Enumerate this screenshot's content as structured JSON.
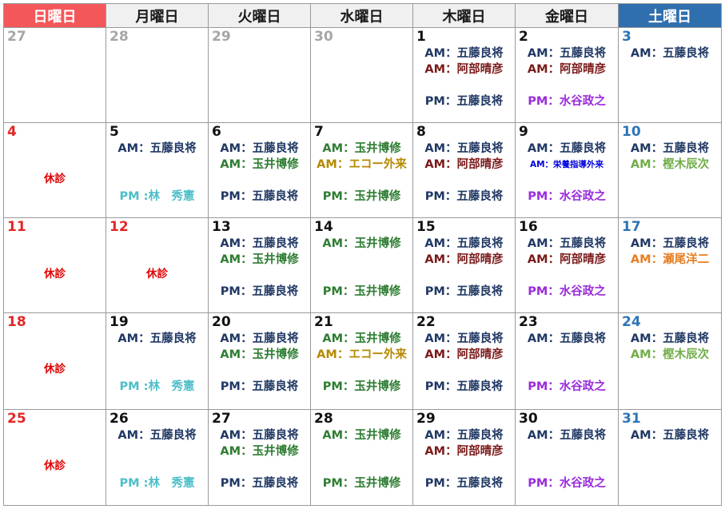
{
  "colors": {
    "sunday_header_bg": "#f4575a",
    "saturday_header_bg": "#2f6fae",
    "header_bg": "#f0f0f0",
    "date_default": "#111111",
    "date_sunday": "#e32626",
    "date_saturday": "#2e75b6",
    "date_other_month": "#a6a6a6",
    "navy": "#203864",
    "maroon": "#7b1a1a",
    "green": "#2e7d32",
    "gold": "#b58900",
    "purple": "#9a2bdc",
    "teal": "#4dbec7",
    "lightgreen": "#70ad47",
    "orange": "#e67e22",
    "red": "#e00000",
    "blue": "#0000dd"
  },
  "weekdays": [
    "日曜日",
    "月曜日",
    "火曜日",
    "水曜日",
    "木曜日",
    "金曜日",
    "土曜日"
  ],
  "weeks": [
    [
      {
        "date": "27",
        "dc": "date_other_month",
        "lines": []
      },
      {
        "date": "28",
        "dc": "date_other_month",
        "lines": []
      },
      {
        "date": "29",
        "dc": "date_other_month",
        "lines": []
      },
      {
        "date": "30",
        "dc": "date_other_month",
        "lines": []
      },
      {
        "date": "1",
        "dc": "date_default",
        "lines": [
          {
            "slot": "am1",
            "text": "AM：五藤良将",
            "color": "navy"
          },
          {
            "slot": "am2",
            "text": "AM：阿部晴彦",
            "color": "maroon"
          },
          {
            "slot": "pm",
            "text": "PM：五藤良将",
            "color": "navy"
          }
        ]
      },
      {
        "date": "2",
        "dc": "date_default",
        "lines": [
          {
            "slot": "am1",
            "text": "AM：五藤良将",
            "color": "navy"
          },
          {
            "slot": "am2",
            "text": "AM：阿部晴彦",
            "color": "maroon"
          },
          {
            "slot": "pm",
            "text": "PM：水谷政之",
            "color": "purple"
          }
        ]
      },
      {
        "date": "3",
        "dc": "date_saturday",
        "lines": [
          {
            "slot": "am1",
            "text": "AM：五藤良将",
            "color": "navy"
          }
        ]
      }
    ],
    [
      {
        "date": "4",
        "dc": "date_sunday",
        "lines": [
          {
            "slot": "closed",
            "text": "休診",
            "color": "red"
          }
        ]
      },
      {
        "date": "5",
        "dc": "date_default",
        "lines": [
          {
            "slot": "am1",
            "text": "AM：五藤良将",
            "color": "navy"
          },
          {
            "slot": "pm",
            "text": "PM :林　秀憲",
            "color": "teal"
          }
        ]
      },
      {
        "date": "6",
        "dc": "date_default",
        "lines": [
          {
            "slot": "am1",
            "text": "AM：五藤良将",
            "color": "navy"
          },
          {
            "slot": "am2",
            "text": "AM：玉井博修",
            "color": "green"
          },
          {
            "slot": "pm",
            "text": "PM：五藤良将",
            "color": "navy"
          }
        ]
      },
      {
        "date": "7",
        "dc": "date_default",
        "lines": [
          {
            "slot": "am1",
            "text": "AM：玉井博修",
            "color": "green"
          },
          {
            "slot": "am2",
            "text": "AM：エコー外来",
            "color": "gold"
          },
          {
            "slot": "pm",
            "text": "PM：玉井博修",
            "color": "green"
          }
        ]
      },
      {
        "date": "8",
        "dc": "date_default",
        "lines": [
          {
            "slot": "am1",
            "text": "AM：五藤良将",
            "color": "navy"
          },
          {
            "slot": "am2",
            "text": "AM：阿部晴彦",
            "color": "maroon"
          },
          {
            "slot": "pm",
            "text": "PM：五藤良将",
            "color": "navy"
          }
        ]
      },
      {
        "date": "9",
        "dc": "date_default",
        "lines": [
          {
            "slot": "am1",
            "text": "AM：五藤良将",
            "color": "navy"
          },
          {
            "slot": "am2",
            "text": "AM：栄養指導外来",
            "color": "blue",
            "small": true
          },
          {
            "slot": "pm",
            "text": "PM：水谷政之",
            "color": "purple"
          }
        ]
      },
      {
        "date": "10",
        "dc": "date_saturday",
        "lines": [
          {
            "slot": "am1",
            "text": "AM：五藤良将",
            "color": "navy"
          },
          {
            "slot": "am2",
            "text": "AM：樫木辰次",
            "color": "lightgreen"
          }
        ]
      }
    ],
    [
      {
        "date": "11",
        "dc": "date_sunday",
        "lines": [
          {
            "slot": "closed",
            "text": "休診",
            "color": "red"
          }
        ]
      },
      {
        "date": "12",
        "dc": "date_sunday",
        "lines": [
          {
            "slot": "closed",
            "text": "休診",
            "color": "red"
          }
        ]
      },
      {
        "date": "13",
        "dc": "date_default",
        "lines": [
          {
            "slot": "am1",
            "text": "AM：五藤良将",
            "color": "navy"
          },
          {
            "slot": "am2",
            "text": "AM：玉井博修",
            "color": "green"
          },
          {
            "slot": "pm",
            "text": "PM：五藤良将",
            "color": "navy"
          }
        ]
      },
      {
        "date": "14",
        "dc": "date_default",
        "lines": [
          {
            "slot": "am1",
            "text": "AM：玉井博修",
            "color": "green"
          },
          {
            "slot": "pm",
            "text": "PM：玉井博修",
            "color": "green"
          }
        ]
      },
      {
        "date": "15",
        "dc": "date_default",
        "lines": [
          {
            "slot": "am1",
            "text": "AM：五藤良将",
            "color": "navy"
          },
          {
            "slot": "am2",
            "text": "AM：阿部晴彦",
            "color": "maroon"
          },
          {
            "slot": "pm",
            "text": "PM：五藤良将",
            "color": "navy"
          }
        ]
      },
      {
        "date": "16",
        "dc": "date_default",
        "lines": [
          {
            "slot": "am1",
            "text": "AM：五藤良将",
            "color": "navy"
          },
          {
            "slot": "am2",
            "text": "AM：阿部晴彦",
            "color": "maroon"
          },
          {
            "slot": "pm",
            "text": "PM：水谷政之",
            "color": "purple"
          }
        ]
      },
      {
        "date": "17",
        "dc": "date_saturday",
        "lines": [
          {
            "slot": "am1",
            "text": "AM：五藤良将",
            "color": "navy"
          },
          {
            "slot": "am2",
            "text": "AM：瀬尾洋二",
            "color": "orange"
          }
        ]
      }
    ],
    [
      {
        "date": "18",
        "dc": "date_sunday",
        "lines": [
          {
            "slot": "closed",
            "text": "休診",
            "color": "red"
          }
        ]
      },
      {
        "date": "19",
        "dc": "date_default",
        "lines": [
          {
            "slot": "am1",
            "text": "AM：五藤良将",
            "color": "navy"
          },
          {
            "slot": "pm",
            "text": "PM :林　秀憲",
            "color": "teal"
          }
        ]
      },
      {
        "date": "20",
        "dc": "date_default",
        "lines": [
          {
            "slot": "am1",
            "text": "AM：五藤良将",
            "color": "navy"
          },
          {
            "slot": "am2",
            "text": "AM：玉井博修",
            "color": "green"
          },
          {
            "slot": "pm",
            "text": "PM：五藤良将",
            "color": "navy"
          }
        ]
      },
      {
        "date": "21",
        "dc": "date_default",
        "lines": [
          {
            "slot": "am1",
            "text": "AM：玉井博修",
            "color": "green"
          },
          {
            "slot": "am2",
            "text": "AM：エコー外来",
            "color": "gold"
          },
          {
            "slot": "pm",
            "text": "PM：玉井博修",
            "color": "green"
          }
        ]
      },
      {
        "date": "22",
        "dc": "date_default",
        "lines": [
          {
            "slot": "am1",
            "text": "AM：五藤良将",
            "color": "navy"
          },
          {
            "slot": "am2",
            "text": "AM：阿部晴彦",
            "color": "maroon"
          },
          {
            "slot": "pm",
            "text": "PM：五藤良将",
            "color": "navy"
          }
        ]
      },
      {
        "date": "23",
        "dc": "date_default",
        "lines": [
          {
            "slot": "am1",
            "text": "AM：五藤良将",
            "color": "navy"
          },
          {
            "slot": "pm",
            "text": "PM：水谷政之",
            "color": "purple"
          }
        ]
      },
      {
        "date": "24",
        "dc": "date_saturday",
        "lines": [
          {
            "slot": "am1",
            "text": "AM：五藤良将",
            "color": "navy"
          },
          {
            "slot": "am2",
            "text": "AM：樫木辰次",
            "color": "lightgreen"
          }
        ]
      }
    ],
    [
      {
        "date": "25",
        "dc": "date_sunday",
        "lines": [
          {
            "slot": "closed",
            "text": "休診",
            "color": "red"
          }
        ]
      },
      {
        "date": "26",
        "dc": "date_default",
        "lines": [
          {
            "slot": "am1",
            "text": "AM：五藤良将",
            "color": "navy"
          },
          {
            "slot": "pm",
            "text": "PM :林　秀憲",
            "color": "teal"
          }
        ]
      },
      {
        "date": "27",
        "dc": "date_default",
        "lines": [
          {
            "slot": "am1",
            "text": "AM：五藤良将",
            "color": "navy"
          },
          {
            "slot": "am2",
            "text": "AM：玉井博修",
            "color": "green"
          },
          {
            "slot": "pm",
            "text": "PM：五藤良将",
            "color": "navy"
          }
        ]
      },
      {
        "date": "28",
        "dc": "date_default",
        "lines": [
          {
            "slot": "am1",
            "text": "AM：玉井博修",
            "color": "green"
          },
          {
            "slot": "pm",
            "text": "PM：玉井博修",
            "color": "green"
          }
        ]
      },
      {
        "date": "29",
        "dc": "date_default",
        "lines": [
          {
            "slot": "am1",
            "text": "AM：五藤良将",
            "color": "navy"
          },
          {
            "slot": "am2",
            "text": "AM：阿部晴彦",
            "color": "maroon"
          },
          {
            "slot": "pm",
            "text": "PM：五藤良将",
            "color": "navy"
          }
        ]
      },
      {
        "date": "30",
        "dc": "date_default",
        "lines": [
          {
            "slot": "am1",
            "text": "AM：五藤良将",
            "color": "navy"
          },
          {
            "slot": "pm",
            "text": "PM：水谷政之",
            "color": "purple"
          }
        ]
      },
      {
        "date": "31",
        "dc": "date_saturday",
        "lines": [
          {
            "slot": "am1",
            "text": "AM：五藤良将",
            "color": "navy"
          }
        ]
      }
    ]
  ]
}
